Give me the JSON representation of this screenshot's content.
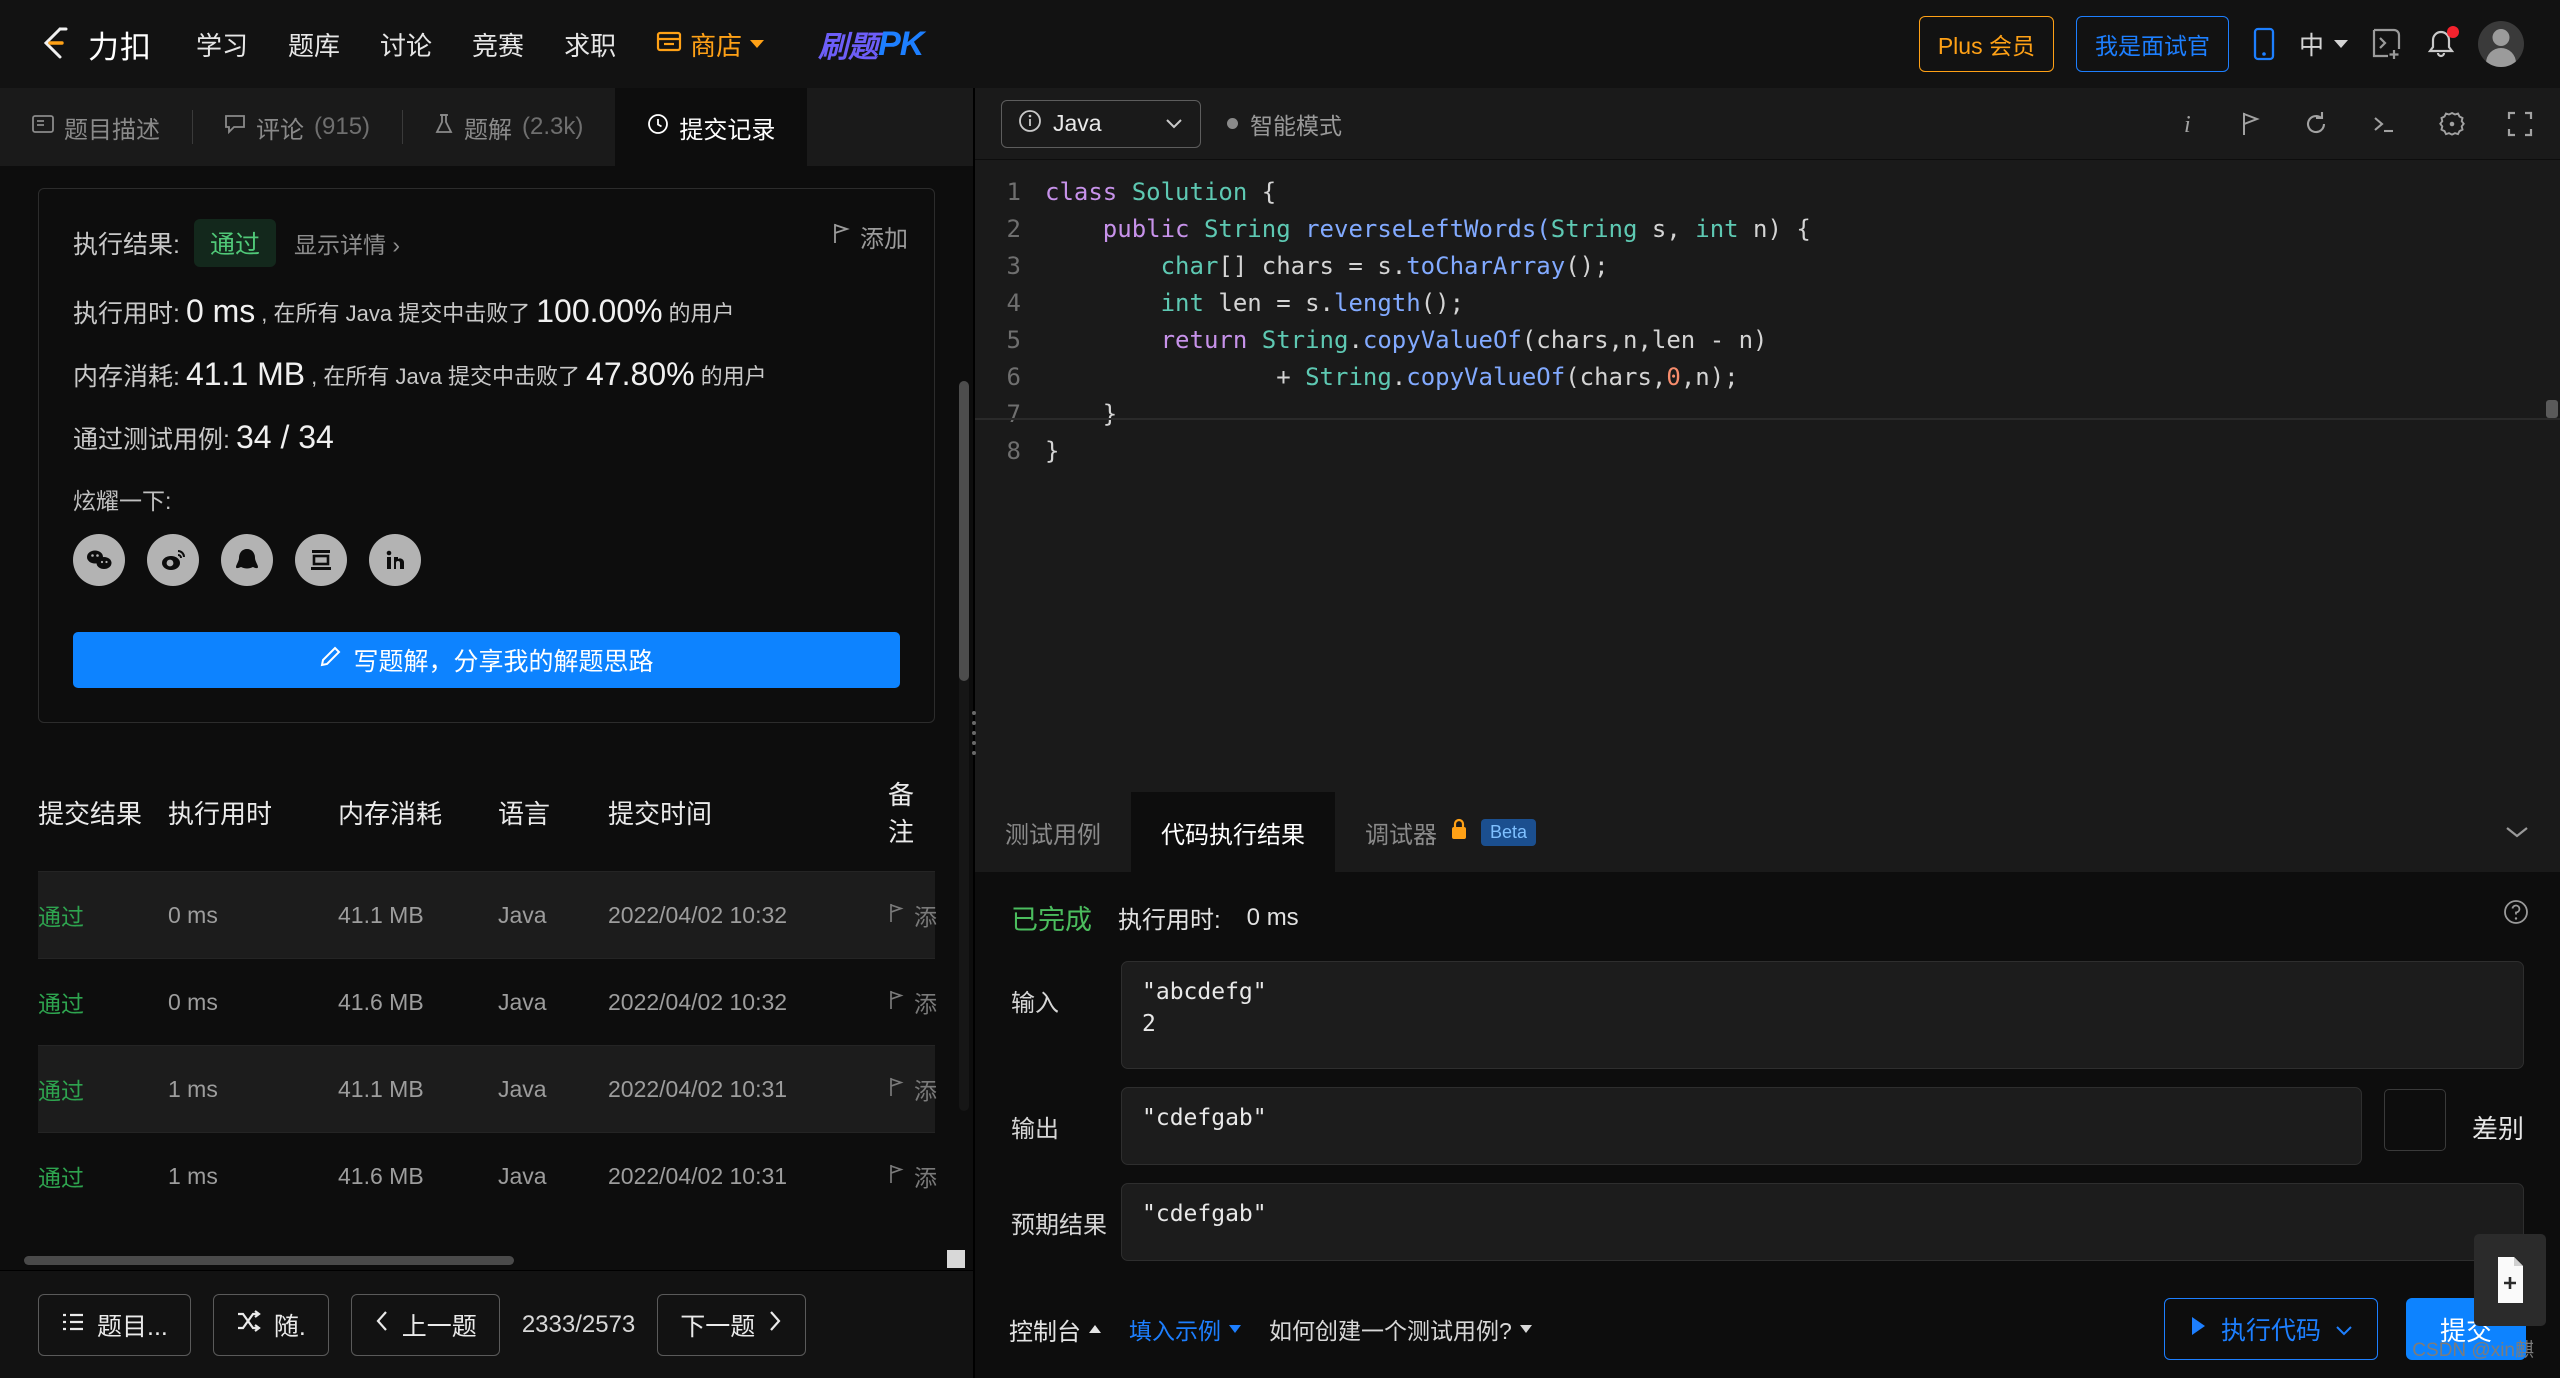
{
  "header": {
    "logo_text": "力扣",
    "nav": [
      {
        "label": "学习"
      },
      {
        "label": "题库"
      },
      {
        "label": "讨论"
      },
      {
        "label": "竞赛"
      },
      {
        "label": "求职"
      }
    ],
    "shop_label": "商店",
    "pk_cn": "刷题",
    "pk_en": "PK",
    "plus_label": "Plus 会员",
    "interviewer_label": "我是面试官",
    "language_label": "中",
    "accent_orange": "#ffa116",
    "accent_blue": "#1d7fff"
  },
  "left_tabs": [
    {
      "label": "题目描述",
      "icon": "description-icon",
      "count": ""
    },
    {
      "label": "评论",
      "icon": "comment-icon",
      "count": "(915)"
    },
    {
      "label": "题解",
      "icon": "flask-icon",
      "count": "(2.3k)"
    },
    {
      "label": "提交记录",
      "icon": "clock-icon",
      "count": ""
    }
  ],
  "result": {
    "exec_result_label": "执行结果:",
    "status": "通过",
    "show_detail": "显示详情 ›",
    "add_note": "添加",
    "runtime_label": "执行用时:",
    "runtime_value": "0 ms",
    "runtime_mid": ", 在所有 Java 提交中击败了",
    "runtime_pct": "100.00%",
    "runtime_tail": "的用户",
    "memory_label": "内存消耗:",
    "memory_value": "41.1 MB",
    "memory_mid": ", 在所有 Java 提交中击败了",
    "memory_pct": "47.80%",
    "memory_tail": "的用户",
    "testcases_label": "通过测试用例:",
    "testcases_value": "34 / 34",
    "share_label": "炫耀一下:",
    "share_icons": [
      "wechat-icon",
      "weibo-icon",
      "qq-icon",
      "douban-icon",
      "linkedin-icon"
    ],
    "write_solution": "写题解，分享我的解题思路"
  },
  "submissions": {
    "columns": [
      "提交结果",
      "执行用时",
      "内存消耗",
      "语言",
      "提交时间",
      "备注"
    ],
    "rows": [
      {
        "status": "通过",
        "runtime": "0 ms",
        "memory": "41.1 MB",
        "lang": "Java",
        "time": "2022/04/02 10:32",
        "note": "添"
      },
      {
        "status": "通过",
        "runtime": "0 ms",
        "memory": "41.6 MB",
        "lang": "Java",
        "time": "2022/04/02 10:32",
        "note": "添"
      },
      {
        "status": "通过",
        "runtime": "1 ms",
        "memory": "41.1 MB",
        "lang": "Java",
        "time": "2022/04/02 10:31",
        "note": "添"
      },
      {
        "status": "通过",
        "runtime": "1 ms",
        "memory": "41.6 MB",
        "lang": "Java",
        "time": "2022/04/02 10:31",
        "note": "添"
      }
    ]
  },
  "left_bottom": {
    "list_label": "题目...",
    "random_label": "随.",
    "prev_label": "上一题",
    "page": "2333/2573",
    "next_label": "下一题"
  },
  "editor": {
    "language": "Java",
    "smart_mode": "智能模式",
    "tools": [
      "info-icon",
      "flag-icon",
      "reset-icon",
      "terminal-icon",
      "settings-icon",
      "fullscreen-icon"
    ],
    "code_lines": [
      {
        "n": "1",
        "segments": [
          {
            "t": "class ",
            "c": "kw"
          },
          {
            "t": "Solution",
            "c": "ty"
          },
          {
            "t": " {",
            "c": "pl"
          }
        ]
      },
      {
        "n": "2",
        "segments": [
          {
            "t": "    public ",
            "c": "kw"
          },
          {
            "t": "String",
            "c": "ty"
          },
          {
            "t": " reverseLeftWords(",
            "c": "fn"
          },
          {
            "t": "String",
            "c": "ty"
          },
          {
            "t": " s, ",
            "c": "pl"
          },
          {
            "t": "int",
            "c": "ty"
          },
          {
            "t": " n) {",
            "c": "pl"
          }
        ]
      },
      {
        "n": "3",
        "segments": [
          {
            "t": "        char",
            "c": "ty"
          },
          {
            "t": "[] chars = s.",
            "c": "pl"
          },
          {
            "t": "toCharArray",
            "c": "fn"
          },
          {
            "t": "();",
            "c": "pl"
          }
        ]
      },
      {
        "n": "4",
        "segments": [
          {
            "t": "        int",
            "c": "ty"
          },
          {
            "t": " len = s.",
            "c": "pl"
          },
          {
            "t": "length",
            "c": "fn"
          },
          {
            "t": "();",
            "c": "pl"
          }
        ]
      },
      {
        "n": "5",
        "segments": [
          {
            "t": "        return ",
            "c": "kw"
          },
          {
            "t": "String",
            "c": "ty"
          },
          {
            "t": ".",
            "c": "pl"
          },
          {
            "t": "copyValueOf",
            "c": "fn"
          },
          {
            "t": "(chars,n,len - n)",
            "c": "pl"
          }
        ]
      },
      {
        "n": "6",
        "segments": [
          {
            "t": "                + ",
            "c": "pl"
          },
          {
            "t": "String",
            "c": "ty"
          },
          {
            "t": ".",
            "c": "pl"
          },
          {
            "t": "copyValueOf",
            "c": "fn"
          },
          {
            "t": "(chars,",
            "c": "pl"
          },
          {
            "t": "0",
            "c": "nm"
          },
          {
            "t": ",n);",
            "c": "pl"
          }
        ]
      },
      {
        "n": "7",
        "segments": [
          {
            "t": "    }",
            "c": "pl"
          }
        ]
      },
      {
        "n": "8",
        "segments": [
          {
            "t": "}",
            "c": "pl"
          }
        ]
      }
    ]
  },
  "console": {
    "tabs": [
      {
        "label": "测试用例"
      },
      {
        "label": "代码执行结果"
      },
      {
        "label": "调试器"
      }
    ],
    "debugger_beta": "Beta",
    "debugger_lock": "lock-icon",
    "status": "已完成",
    "runtime_label": "执行用时:",
    "runtime_value": "0 ms",
    "input_label": "输入",
    "input_value": "\"abcdefg\"\n2",
    "output_label": "输出",
    "output_value": "\"cdefgab\"",
    "expected_label": "预期结果",
    "expected_value": "\"cdefgab\"",
    "diff_label": "差别"
  },
  "right_bottom": {
    "console_label": "控制台",
    "fill_example": "填入示例",
    "how_to": "如何创建一个测试用例?",
    "run_code": "执行代码",
    "submit": "提交",
    "watermark": "CSDN @xin麒"
  }
}
